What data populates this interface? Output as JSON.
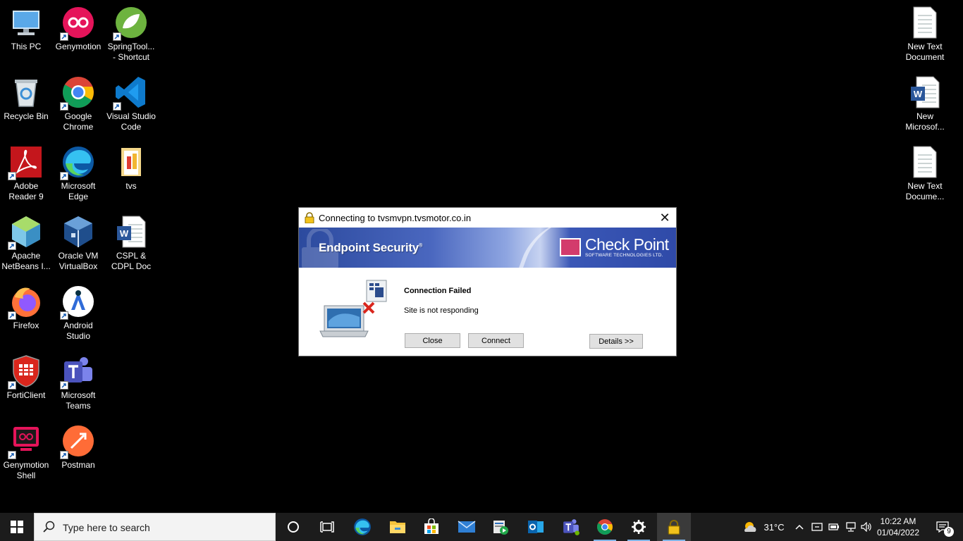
{
  "desktop": {
    "icons": [
      {
        "id": "this-pc",
        "label": "This PC"
      },
      {
        "id": "genymotion",
        "label": "Genymotion"
      },
      {
        "id": "springtool",
        "label": "SpringTool...\n- Shortcut"
      },
      {
        "id": "recycle-bin",
        "label": "Recycle Bin"
      },
      {
        "id": "google-chrome",
        "label": "Google\nChrome"
      },
      {
        "id": "vscode",
        "label": "Visual Studio\nCode"
      },
      {
        "id": "adobe-reader",
        "label": "Adobe\nReader 9"
      },
      {
        "id": "microsoft-edge",
        "label": "Microsoft\nEdge"
      },
      {
        "id": "tvs-folder",
        "label": "tvs"
      },
      {
        "id": "apache-netbeans",
        "label": "Apache\nNetBeans I..."
      },
      {
        "id": "oracle-vm",
        "label": "Oracle VM\nVirtualBox"
      },
      {
        "id": "cspl-doc",
        "label": "CSPL &\nCDPL Doc"
      },
      {
        "id": "firefox",
        "label": "Firefox"
      },
      {
        "id": "android-studio",
        "label": "Android\nStudio"
      },
      {
        "id": "forticlient",
        "label": "FortiClient"
      },
      {
        "id": "ms-teams",
        "label": "Microsoft\nTeams"
      },
      {
        "id": "genymotion-shell",
        "label": "Genymotion\nShell"
      },
      {
        "id": "postman",
        "label": "Postman"
      },
      {
        "id": "new-text-1",
        "label": "New Text\nDocument"
      },
      {
        "id": "new-word",
        "label": "New\nMicrosof..."
      },
      {
        "id": "new-text-2",
        "label": "New Text\nDocume..."
      }
    ]
  },
  "dialog": {
    "title": "Connecting to tvsmvpn.tvsmotor.co.in",
    "banner_product": "Endpoint Security",
    "banner_brand": "Check Point",
    "banner_brand_sub": "SOFTWARE TECHNOLOGIES LTD.",
    "status_title": "Connection Failed",
    "status_message": "Site is not responding",
    "close_label": "Close",
    "connect_label": "Connect",
    "details_label": "Details >>"
  },
  "taskbar": {
    "search_placeholder": "Type here to search",
    "weather_temp": "31°C",
    "time": "10:22 AM",
    "date": "01/04/2022",
    "notification_count": "9"
  },
  "colors": {
    "taskbar_bg": "#1c1c1c",
    "banner_blue": "#2c4a9e",
    "accent_underline": "#7fb4e6"
  }
}
